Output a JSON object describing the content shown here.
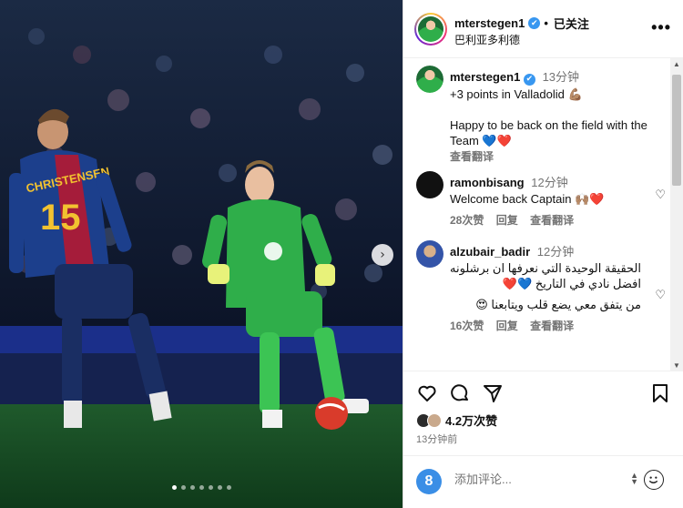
{
  "post": {
    "photo_alt": "",
    "carousel_count": 7,
    "carousel_active": 1
  },
  "header": {
    "username": "mterstegen1",
    "follow_label": "已关注",
    "location": "巴利亚多利德",
    "verified_icon": "✔",
    "more_label": "•••"
  },
  "caption": {
    "username": "mterstegen1",
    "time": "13分钟",
    "line1": "+3 points in Valladolid 💪🏽",
    "line2": "Happy to be back on the field with the Team 💙❤️",
    "translate": "查看翻译"
  },
  "comments": [
    {
      "username": "ramonbisang",
      "time": "12分钟",
      "text": "Welcome back Captain 🙌🏽❤️",
      "likes": "28次赞",
      "reply": "回复",
      "translate": "查看翻译"
    },
    {
      "username": "alzubair_badir",
      "time": "12分钟",
      "text1": "الحقيقة الوحيدة التي نعرفها ان برشلونه افضل نادي في التاريخ 💙❤️",
      "text2": "من يتفق معي يضع قلب ويتابعنا 😍",
      "likes": "16次赞",
      "reply": "回复",
      "translate": "查看翻译"
    }
  ],
  "footer": {
    "likes": "4.2万次赞",
    "time_ago": "13分钟前",
    "add_comment_placeholder": "添加评论...",
    "add_avatar_letter": "8"
  },
  "colors": {
    "verified": "#3897f0",
    "keeper_kit": "#2fae4a",
    "barca_blue": "#1c3f8c",
    "barca_red": "#a51c3a"
  }
}
